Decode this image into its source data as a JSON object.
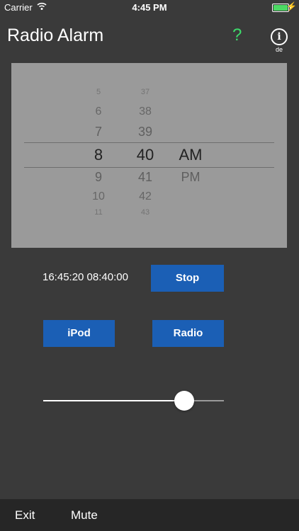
{
  "status_bar": {
    "carrier": "Carrier",
    "time": "4:45 PM",
    "battery_level": 1.0
  },
  "header": {
    "title": "Radio Alarm",
    "help_label": "?",
    "info_label": "i",
    "language_label": "de"
  },
  "picker": {
    "hours": [
      "5",
      "6",
      "7",
      "8",
      "9",
      "10",
      "11"
    ],
    "minutes": [
      "37",
      "38",
      "39",
      "40",
      "41",
      "42",
      "43"
    ],
    "periods": [
      "AM",
      "PM"
    ],
    "selected": {
      "hour": "8",
      "minute": "40",
      "period": "AM"
    }
  },
  "controls": {
    "time_readout": "16:45:20 08:40:00",
    "stop_label": "Stop",
    "ipod_label": "iPod",
    "radio_label": "Radio",
    "volume_level": 0.78
  },
  "bottom_bar": {
    "exit_label": "Exit",
    "mute_label": "Mute"
  },
  "colors": {
    "background": "#3a3a3a",
    "button": "#1b5fb5",
    "help_accent": "#3ddb6b",
    "picker_bg": "#9a9a9a",
    "bottom_bar": "#262626",
    "battery": "#4cd964"
  }
}
